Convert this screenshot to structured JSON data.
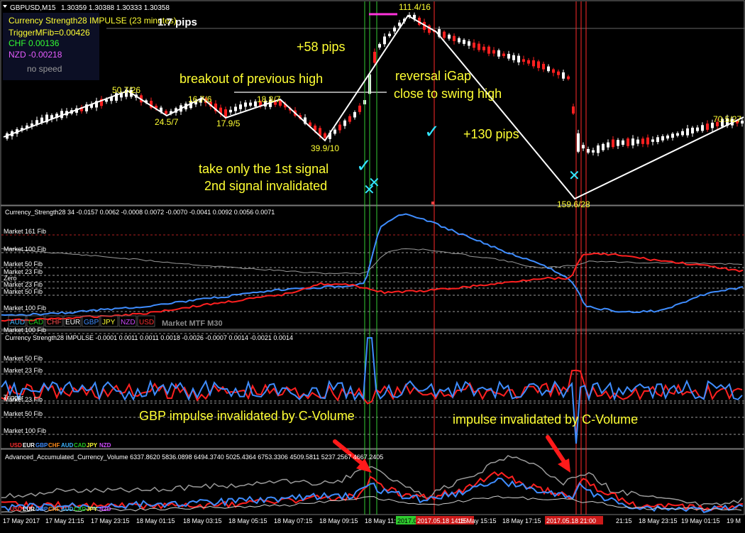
{
  "window": {
    "title": "GBPUSD,M15",
    "ohlc": "1.30359 1.30388 1.30333 1.30358"
  },
  "info": {
    "indicator": "Currency Strength28 IMPULSE (23 minutes)",
    "trigger": "TriggerMFib=0.00426",
    "chf": "CHF 0.00136",
    "nzd": "NZD -0.00218",
    "speed": "no speed",
    "pips": "1.7 pips"
  },
  "annotations": {
    "pips58": "+58 pips",
    "breakout": "breakout of previous high",
    "reversal1": "reversal iGap",
    "reversal2": "close to swing high",
    "pips130": "+130 pips",
    "take1": "take only the 1st signal",
    "take2": "2nd signal invalidated",
    "gbp_impulse": "GBP impulse invalidated by C-Volume",
    "impulse": "impulse invalidated by C-Volume"
  },
  "zigzag_labels": [
    "50.7/26",
    "24.5/7",
    "16.7/6",
    "17.9/5",
    "18.8/7",
    "39.9/10",
    "111.4/16",
    "159.6/28",
    "70.5/27"
  ],
  "panel2": {
    "header": "Currency_Strength28 34 -0.0157 0.0062 -0.0008 0.0072 -0.0070 -0.0041 0.0092 0.0056 0.0071",
    "levels": [
      "Market 161 Fib",
      "Market 100 Fib",
      "Market 50 Fib",
      "Market 23 Fib",
      "Zero",
      "Market 23 Fib",
      "Market 50 Fib",
      "Market 100 Fib"
    ],
    "legend": [
      "AUD",
      "CAD",
      "CHF",
      "EUR",
      "GBP",
      "JPY",
      "NZD",
      "USD"
    ],
    "legend_colors": [
      "#3cb4ff",
      "#21c821",
      "#ff4d4d",
      "#ffffff",
      "#3f8dff",
      "#ffff33",
      "#d04bff",
      "#ff3030"
    ],
    "mtf": "Market    MTF M30"
  },
  "panel3": {
    "header": "Currency Strength28 IMPULSE  -0.0001 0.0011 0.0011 0.0018 -0.0026 -0.0007 0.0014 -0.0021 0.0014",
    "levels": [
      "Market 100 Fib",
      "Market 50 Fib",
      "Market 23 Fib",
      "Trigger",
      "Market 23 Fib",
      "Market 50 Fib",
      "Market 100 Fib"
    ]
  },
  "panel4": {
    "header": "Advanced_Accumulated_Currency_Volume  6337.8620 5836.0898 6494.3740 5025.4364 6753.3306 4509.5811 5237.2567 4667.2405",
    "legend": [
      "USD",
      "EUR",
      "GBP",
      "CHF",
      "AUD",
      "CAD",
      "JPY",
      "NZD"
    ],
    "legend_colors": [
      "#ff3030",
      "#ffffff",
      "#3f8dff",
      "#ff8c1a",
      "#3cb4ff",
      "#21c821",
      "#ffff33",
      "#d04bff"
    ]
  },
  "time_axis": [
    "17 May 2017",
    "17 May 21:15",
    "17 May 23:15",
    "18 May 01:15",
    "18 May 03:15",
    "18 May 05:15",
    "18 May 07:15",
    "18 May 09:15",
    "18 May 11:15",
    "2017.05.18 11:45",
    "2017.05.18 14:15",
    "18 May 15:15",
    "18 May 17:15",
    "18 May 19:15",
    "2017.05.18 21:00",
    "21:15",
    "18 May 23:15",
    "19 May 01:15",
    "19 M"
  ],
  "colors": {
    "up": "#ffffff",
    "down": "#ff2020",
    "zigzag": "#ffffff",
    "annotation": "#ffff33",
    "cyan": "#33e6ff",
    "blue_line": "#3f8dff",
    "red_line": "#ff2020",
    "gray_line": "#9a9a9a",
    "green_vline": "#33cc33",
    "red_vline": "#ff2a2a"
  }
}
